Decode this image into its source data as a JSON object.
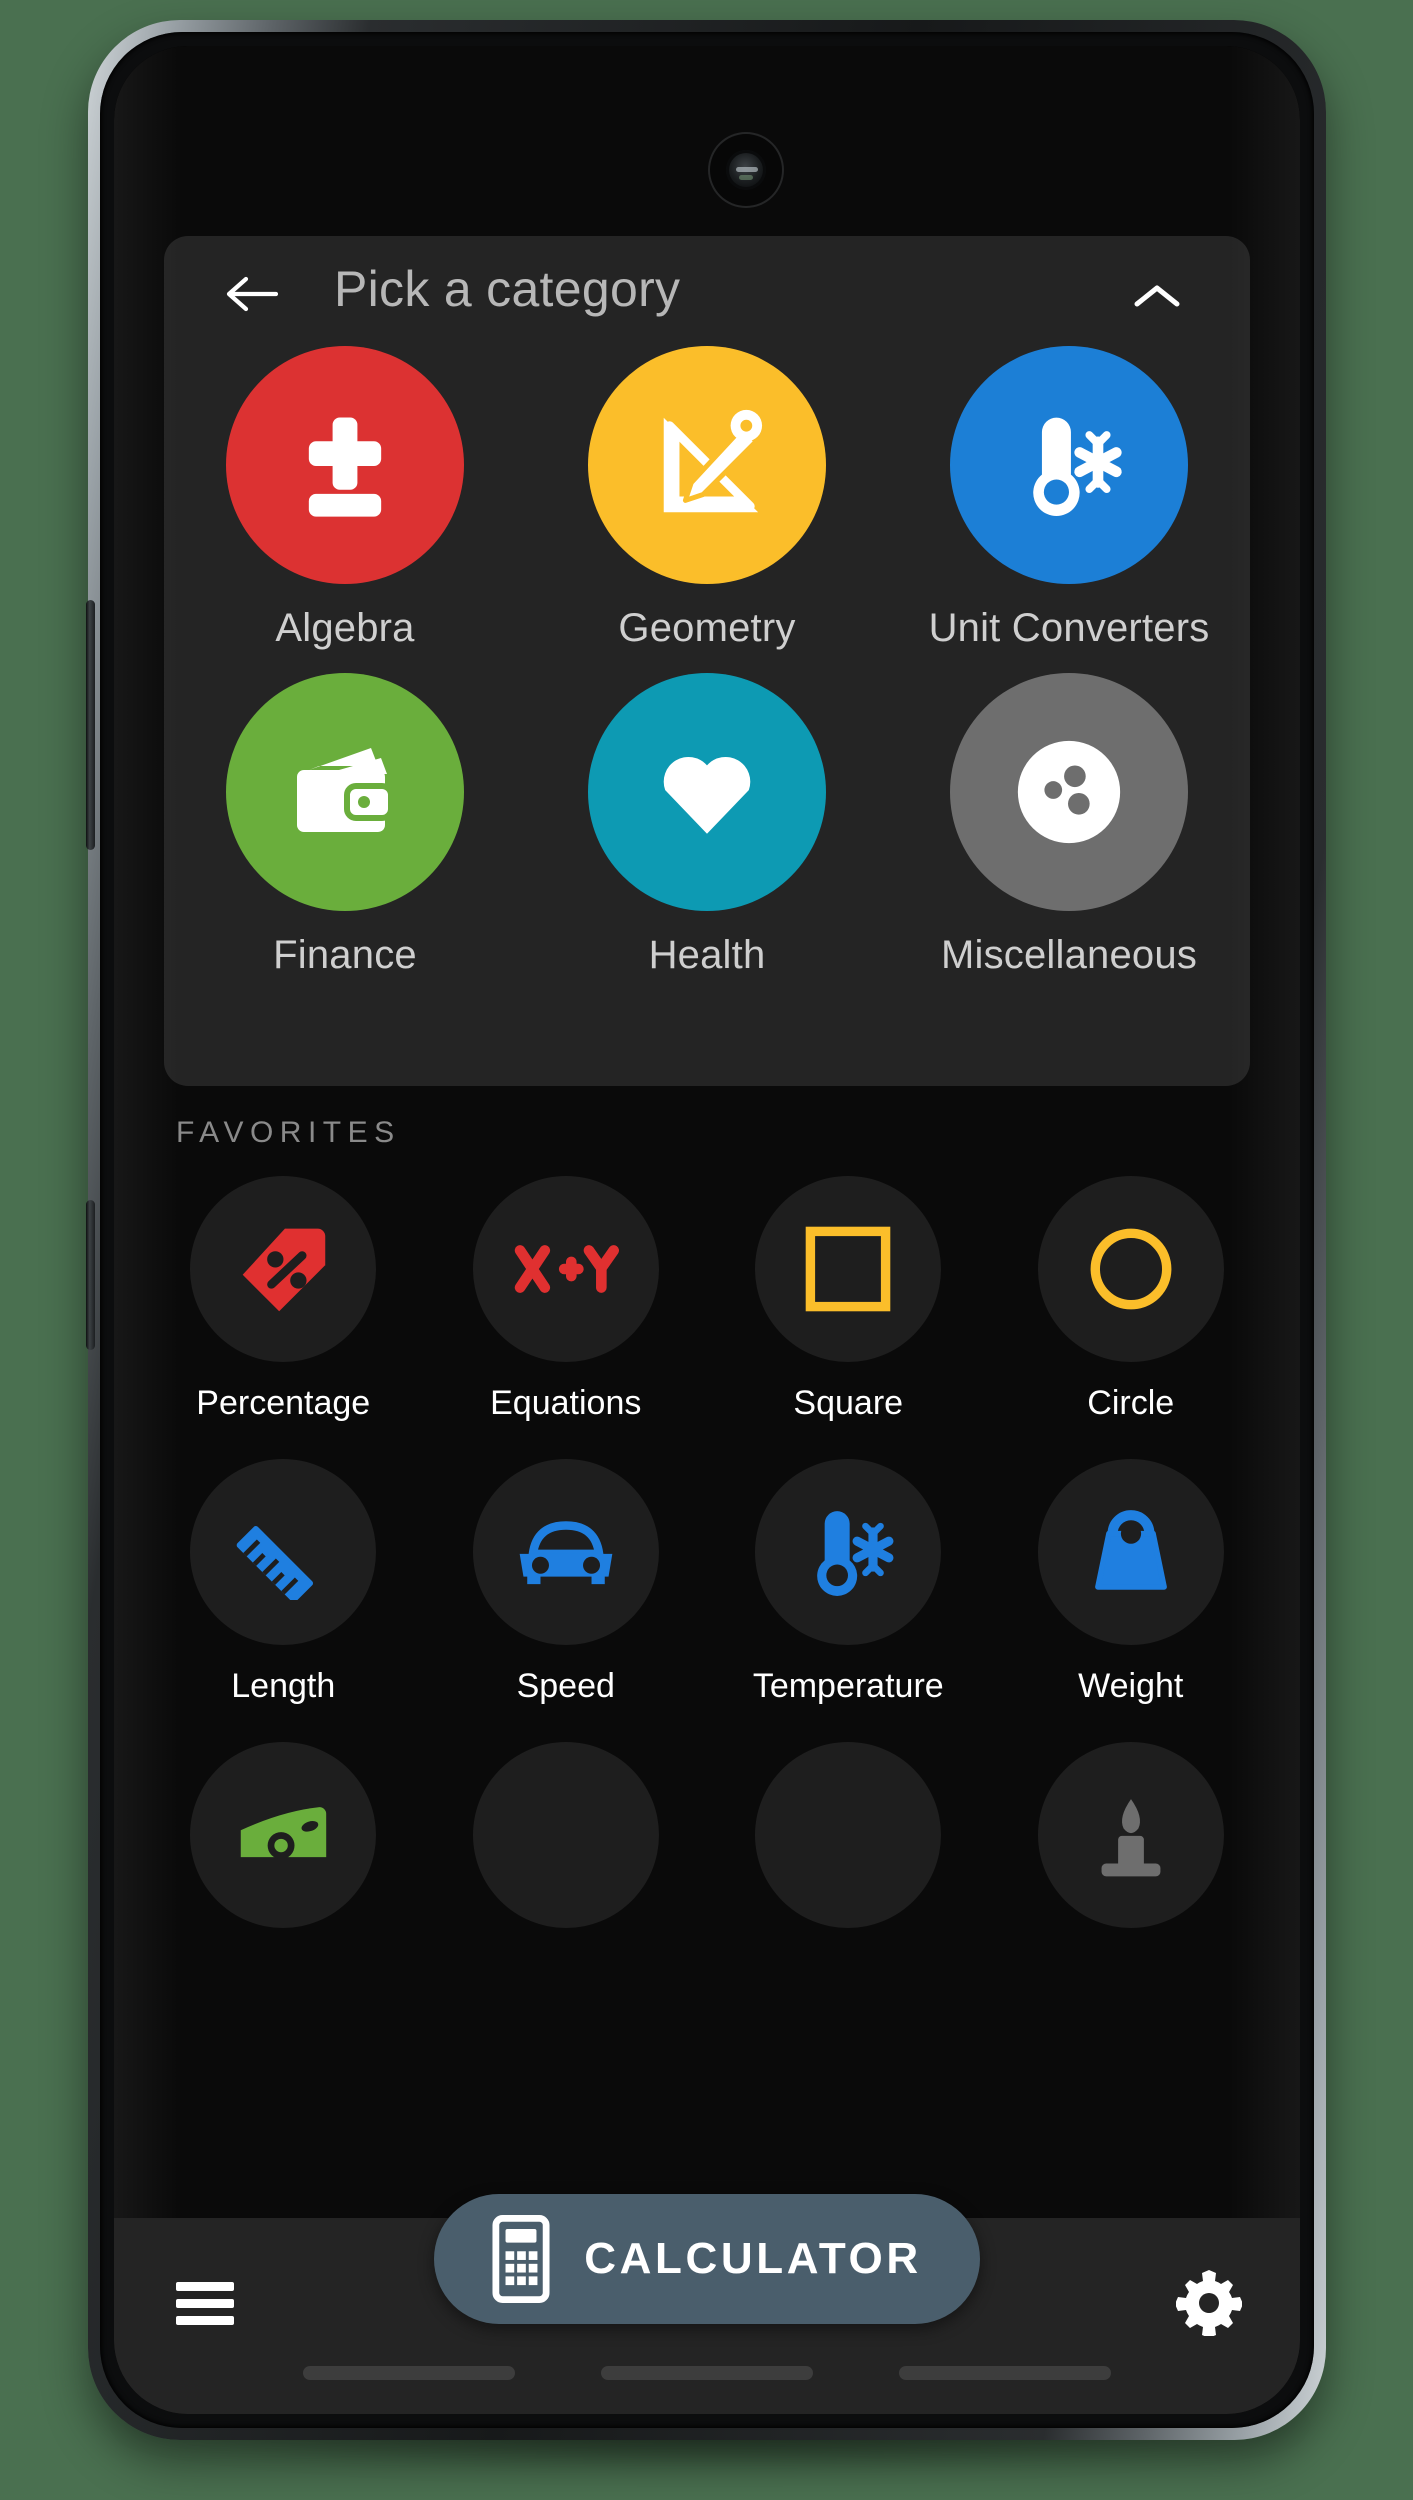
{
  "colors": {
    "page_background": "#4a7050",
    "screen_background": "#0a0a0a",
    "sheet_background": "#242424",
    "favorite_circle": "#1e1e1e",
    "calculator_button": "#4a5e6c",
    "algebra": "#dc3232",
    "geometry": "#fbbe2a",
    "unit_converters": "#1c7fd6",
    "finance": "#6aae3c",
    "health": "#0d9ab3",
    "miscellaneous": "#6e6e6e",
    "accent_red": "#e03030",
    "accent_yellow": "#fbbe2a",
    "accent_blue": "#1f7fe0",
    "accent_green": "#6aae3c",
    "accent_gray": "#6e6e6e"
  },
  "sheet": {
    "title": "Pick a category",
    "back_icon": "back-arrow-icon",
    "collapse_icon": "chevron-up-icon",
    "categories": [
      {
        "label": "Algebra",
        "icon": "plus-minus-icon",
        "color": "#dc3232"
      },
      {
        "label": "Geometry",
        "icon": "ruler-pencil-icon",
        "color": "#fbbe2a"
      },
      {
        "label": "Unit Converters",
        "icon": "thermometer-snowflake-icon",
        "color": "#1c7fd6"
      },
      {
        "label": "Finance",
        "icon": "wallet-icon",
        "color": "#6aae3c"
      },
      {
        "label": "Health",
        "icon": "heart-icon",
        "color": "#0d9ab3"
      },
      {
        "label": "Miscellaneous",
        "icon": "bowling-ball-icon",
        "color": "#6e6e6e"
      }
    ]
  },
  "favorites": {
    "section_title": "FAVORITES",
    "items": [
      {
        "label": "Percentage",
        "icon": "price-tag-percent-icon",
        "color": "#e03030"
      },
      {
        "label": "Equations",
        "icon": "x-plus-y-icon",
        "color": "#e03030"
      },
      {
        "label": "Square",
        "icon": "square-outline-icon",
        "color": "#fbbe2a"
      },
      {
        "label": "Circle",
        "icon": "circle-outline-icon",
        "color": "#fbbe2a"
      },
      {
        "label": "Length",
        "icon": "ruler-icon",
        "color": "#1f7fe0"
      },
      {
        "label": "Speed",
        "icon": "car-icon",
        "color": "#1f7fe0"
      },
      {
        "label": "Temperature",
        "icon": "thermometer-snowflake-icon",
        "color": "#1f7fe0"
      },
      {
        "label": "Weight",
        "icon": "weight-icon",
        "color": "#1f7fe0"
      }
    ],
    "partial_row": [
      {
        "label": "",
        "icon": "banknote-icon",
        "color": "#6aae3c"
      },
      {
        "label": "",
        "icon": "blank-icon",
        "color": "#1e1e1e"
      },
      {
        "label": "",
        "icon": "blank-icon",
        "color": "#1e1e1e"
      },
      {
        "label": "",
        "icon": "candle-icon",
        "color": "#6e6e6e"
      }
    ]
  },
  "calculator": {
    "label": "CALCULATOR",
    "icon": "calculator-icon"
  },
  "bottom_bar": {
    "menu_icon": "hamburger-menu-icon",
    "settings_icon": "gear-icon",
    "system_nav_pills": 3
  },
  "device": {
    "camera_icon": "front-camera-icon"
  }
}
